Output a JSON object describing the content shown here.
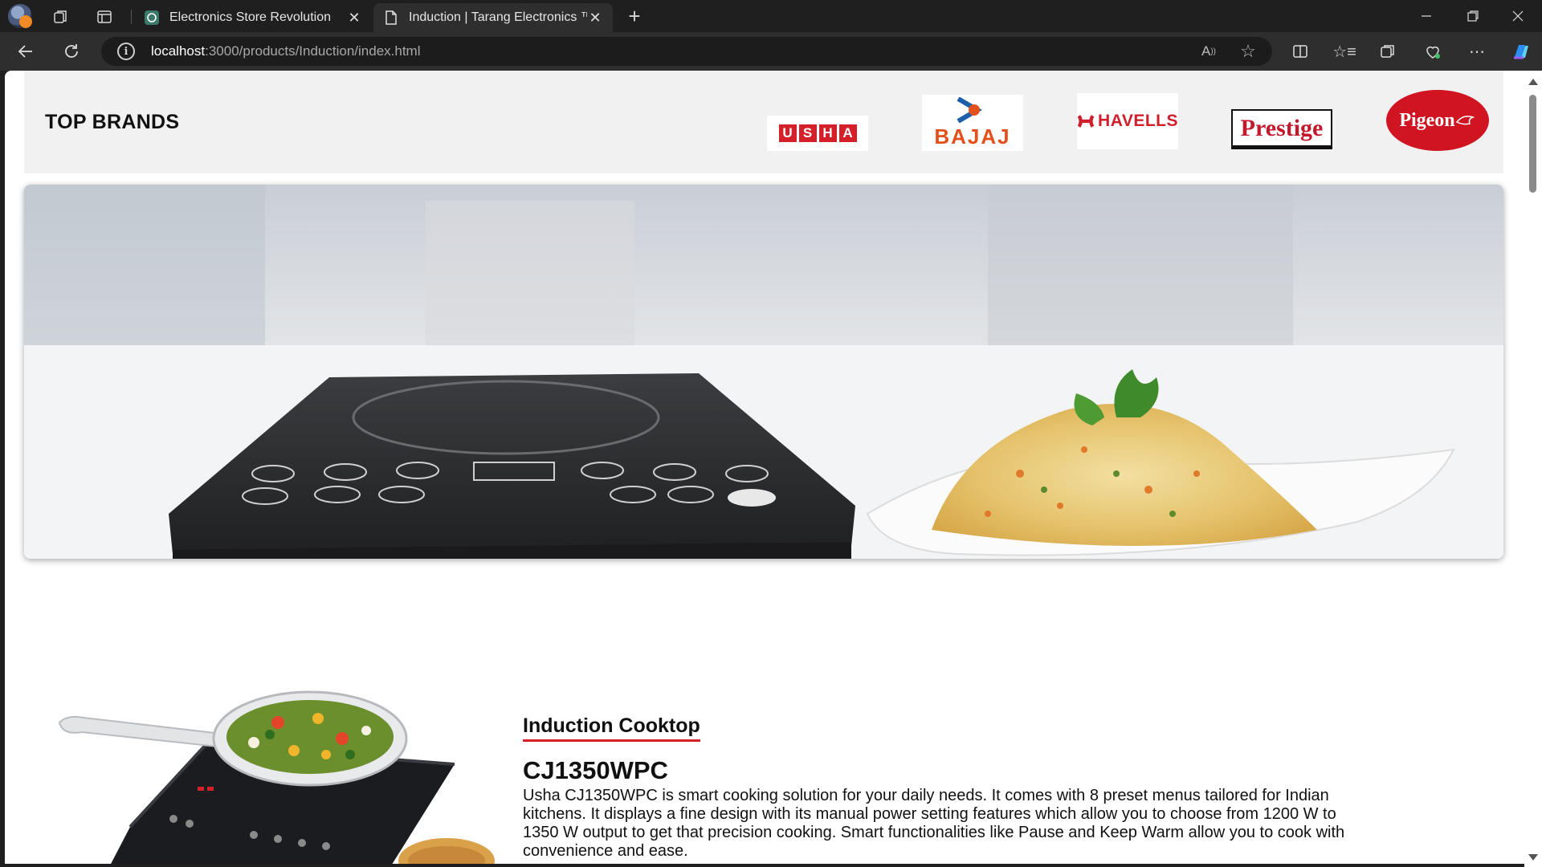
{
  "browser": {
    "tabs": [
      {
        "title": "Electronics Store Revolution",
        "active": false,
        "icon": "chat-icon"
      },
      {
        "title": "Induction | Tarang Electronics ™",
        "active": true,
        "icon": "page-icon"
      }
    ],
    "url_host": "localhost",
    "url_path": ":3000/products/Induction/index.html"
  },
  "brands": {
    "heading": "TOP BRANDS",
    "logos": [
      {
        "name": "USHA",
        "color": "#d5202a"
      },
      {
        "name": "BAJAJ",
        "color": "#e3501c"
      },
      {
        "name": "HAVELLS",
        "color": "#d01e2a"
      },
      {
        "name": "Prestige",
        "color": "#c21a2c"
      },
      {
        "name": "Pigeon",
        "color": "#d01422"
      }
    ]
  },
  "banner": {
    "image": "induction-cooktop-with-biryani"
  },
  "product": {
    "category": "Induction Cooktop",
    "model": "CJ1350WPC",
    "description": "Usha CJ1350WPC is smart cooking solution for your daily needs. It comes with 8 preset menus tailored for Indian kitchens. It displays a fine design with its manual power setting features which allow you to choose from 1200 W to 1350 W output to get that precision cooking. Smart functionalities like Pause and Keep Warm allow you to cook with convenience and ease.",
    "image": "usha-induction-cooktop-with-pan"
  }
}
